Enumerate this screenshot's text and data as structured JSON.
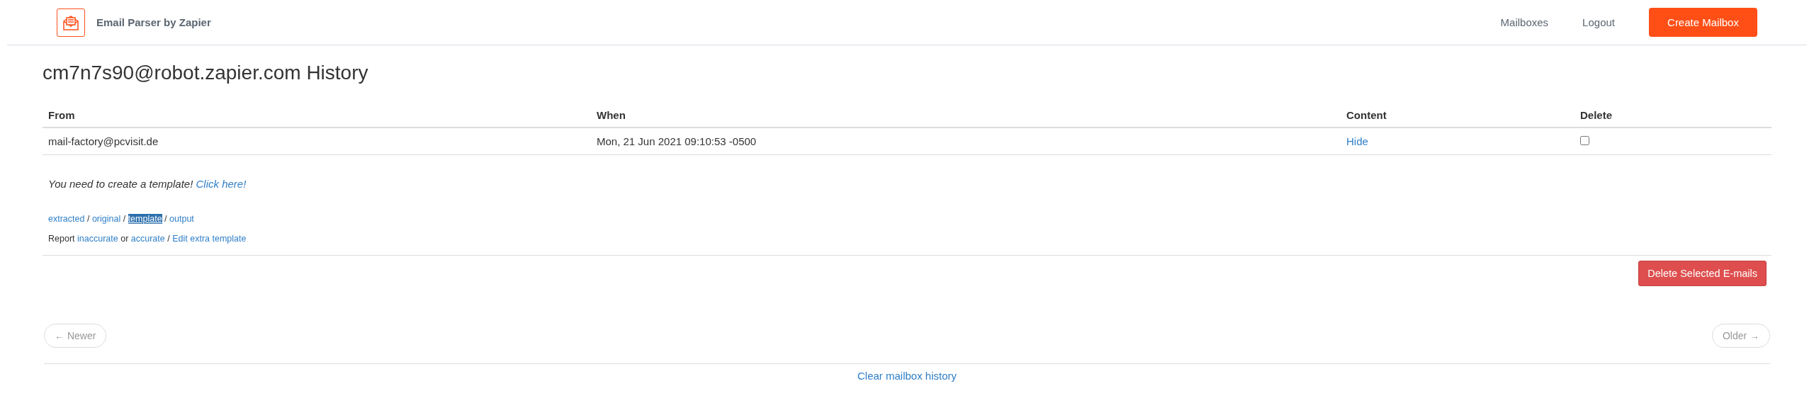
{
  "header": {
    "brand": "Email Parser by Zapier",
    "nav": [
      "Mailboxes",
      "Logout"
    ],
    "primary_button": "Create Mailbox"
  },
  "page_title": "cm7n7s90@robot.zapier.com History",
  "table": {
    "columns": [
      "From",
      "When",
      "Content",
      "Delete"
    ],
    "rows": [
      {
        "from": "mail-factory@pcvisit.de",
        "when": "Mon, 21 Jun 2021 09:10:53 -0500",
        "content_link": "Hide",
        "checked": false
      }
    ]
  },
  "notice": {
    "text": "You need to create a template!",
    "link": "Click here!"
  },
  "views": [
    {
      "label": "extracted",
      "selected": false
    },
    {
      "label": "original",
      "selected": false
    },
    {
      "label": "template",
      "selected": true
    },
    {
      "label": "output",
      "selected": false
    }
  ],
  "view_separator": "/",
  "report": [
    {
      "kind": "text",
      "text": "Report"
    },
    {
      "kind": "link",
      "text": "inaccurate"
    },
    {
      "kind": "text",
      "text": "or"
    },
    {
      "kind": "link",
      "text": "accurate"
    },
    {
      "kind": "text",
      "text": "/"
    },
    {
      "kind": "link",
      "text": "Edit extra template"
    }
  ],
  "delete_button": "Delete Selected E-mails",
  "pager": [
    {
      "label": "← Newer",
      "disabled": true
    },
    {
      "label": "Older →",
      "disabled": true
    }
  ],
  "footer_link": "Clear mailbox history"
}
